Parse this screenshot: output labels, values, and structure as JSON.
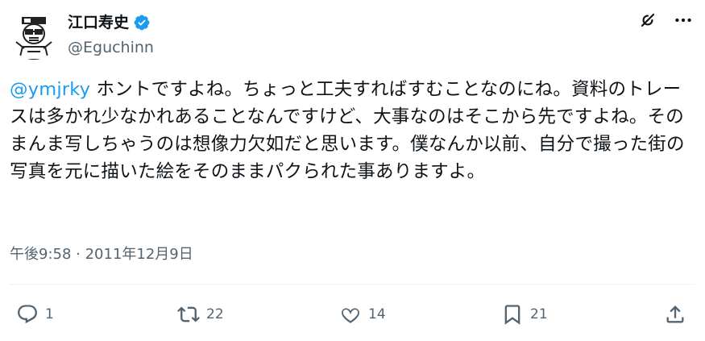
{
  "user": {
    "display_name": "江口寿史",
    "handle": "@Eguchinn",
    "verified": true
  },
  "top_actions": {
    "grok_icon": "grok-icon",
    "more_icon": "more-icon"
  },
  "tweet": {
    "mention": "@ymjrky",
    "text": " ホントですよね。ちょっと工夫すればすむことなのにね。資料のトレースは多かれ少なかれあることなんですけど、大事なのはそこから先ですよね。そのまんま写しちゃうのは想像力欠如だと思います。僕なんか以前、自分で撮った街の写真を元に描いた絵をそのままパクられた事ありますよ。",
    "timestamp": "午後9:58 · 2011年12月9日"
  },
  "actions": {
    "reply_count": "1",
    "repost_count": "22",
    "like_count": "14",
    "bookmark_count": "21"
  },
  "colors": {
    "mention": "#1d9bf0",
    "secondary": "#536471",
    "verified": "#1d9bf0"
  }
}
